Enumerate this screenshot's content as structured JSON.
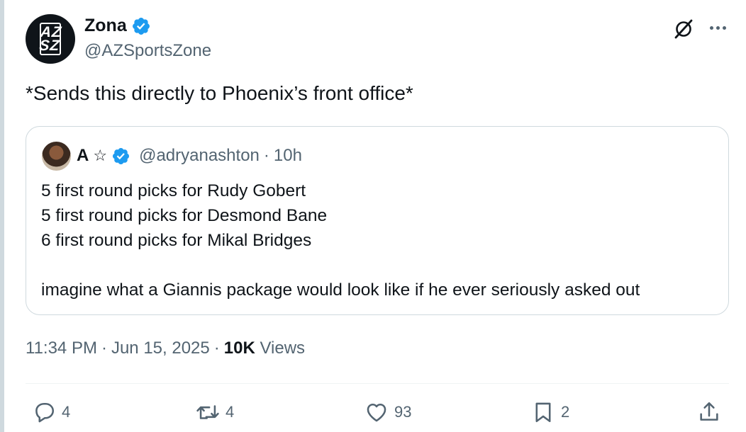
{
  "author": {
    "avatar_text_top": "AZ",
    "avatar_text_bottom": "SZ",
    "display_name": "Zona",
    "handle": "@AZSportsZone",
    "verified": true
  },
  "tweet": {
    "text": "*Sends this directly to Phoenix’s front office*"
  },
  "quote": {
    "display_name": "A",
    "name_symbol": "☆",
    "handle": "@adryanashton",
    "separator": "·",
    "time": "10h",
    "lines": [
      "5 first round picks for Rudy Gobert",
      "5 first round picks for Desmond Bane",
      "6 first round picks for Mikal Bridges",
      "",
      "imagine what a Giannis package would look like if he ever seriously asked out"
    ]
  },
  "meta": {
    "time": "11:34 PM",
    "sep1": "·",
    "date": "Jun 15, 2025",
    "sep2": "·",
    "views_count": "10K",
    "views_label": "Views"
  },
  "actions": {
    "replies": "4",
    "reposts": "4",
    "likes": "93",
    "bookmarks": "2"
  },
  "colors": {
    "verified": "#1d9bf0",
    "secondary_text": "#536471",
    "primary_text": "#0f1419",
    "border": "#cfd9de"
  },
  "icons": [
    "grok-icon",
    "more-icon",
    "reply-icon",
    "retweet-icon",
    "like-icon",
    "bookmark-icon",
    "share-icon",
    "verified-badge-icon"
  ]
}
